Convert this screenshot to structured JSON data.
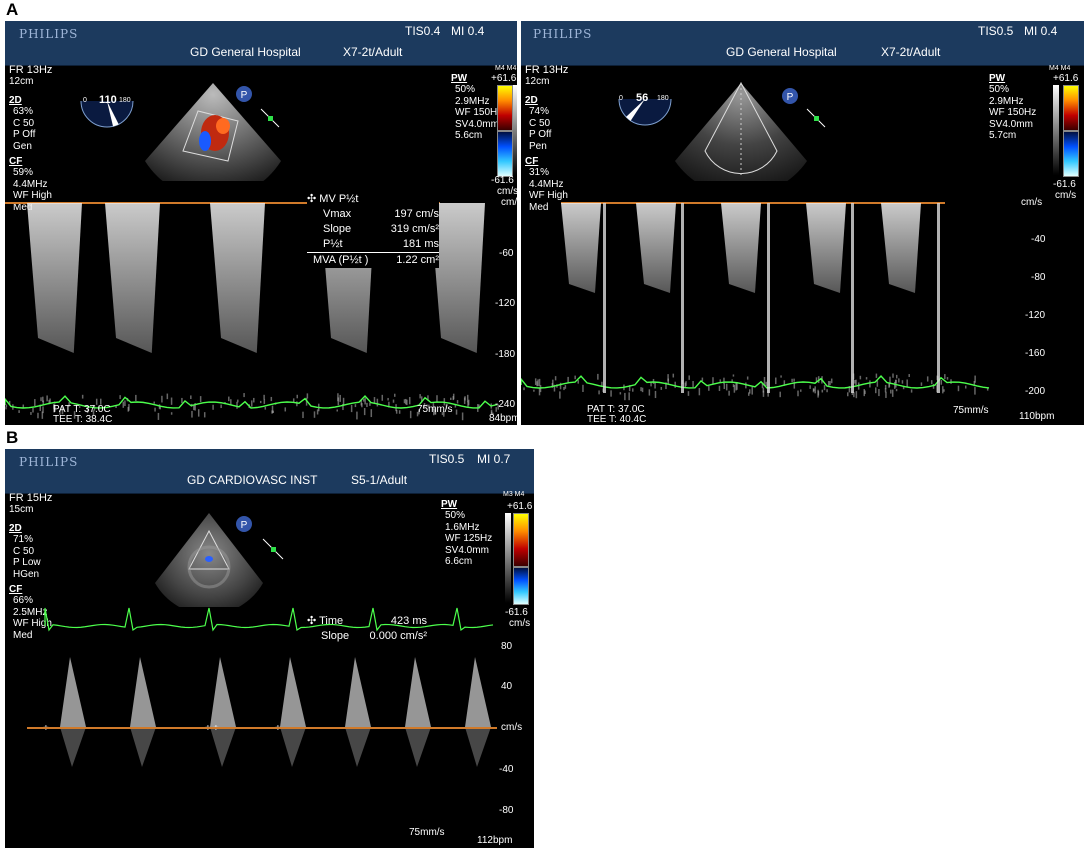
{
  "figure_labels": {
    "a": "A",
    "b": "B"
  },
  "panels": {
    "a1": {
      "logo": "PHILIPS",
      "tis": "TIS0.4",
      "mi": "MI 0.4",
      "hospital": "GD General Hospital",
      "probe": "X7-2t/Adult",
      "fr": "FR 13Hz",
      "depth": "12cm",
      "mode2d": "2D",
      "mode2d_vals": "63%\nC 50\nP Off\nGen",
      "cf": "CF",
      "cf_vals": "59%\n4.4MHz\nWF High\nMed",
      "angle": "110",
      "angle_min": "0",
      "angle_max": "180",
      "pw": "PW",
      "pw_vals": "50%\n2.9MHz\nWF 150Hz\nSV4.0mm\n5.6cm",
      "bar_head": "M4 M4",
      "bar_top": "+61.6",
      "bar_bottom": "-61.6",
      "bar_unit": "cm/s",
      "scale_unit": "cm/s",
      "scale": [
        "-60",
        "-120",
        "-180",
        "-240"
      ],
      "meas_title": "MV P½t",
      "meas": [
        {
          "k": "Vmax",
          "v": "197 cm/s"
        },
        {
          "k": "Slope",
          "v": "319 cm/s²"
        },
        {
          "k": "P½t",
          "v": "181 ms"
        },
        {
          "k": "MVA (P½t )",
          "v": "1.22 cm²"
        }
      ],
      "pat_t": "PAT T: 37.0C",
      "tee_t": "TEE T: 38.4C",
      "speed": "75mm/s",
      "hr": "84bpm"
    },
    "a2": {
      "logo": "PHILIPS",
      "tis": "TIS0.5",
      "mi": "MI 0.4",
      "hospital": "GD General Hospital",
      "probe": "X7-2t/Adult",
      "fr": "FR 13Hz",
      "depth": "12cm",
      "mode2d": "2D",
      "mode2d_vals": "74%\nC 50\nP Off\nPen",
      "cf": "CF",
      "cf_vals": "31%\n4.4MHz\nWF High\nMed",
      "angle": "56",
      "angle_min": "0",
      "angle_max": "180",
      "pw": "PW",
      "pw_vals": "50%\n2.9MHz\nWF 150Hz\nSV4.0mm\n5.7cm",
      "bar_head": "M4 M4",
      "bar_top": "+61.6",
      "bar_bottom": "-61.6",
      "bar_unit": "cm/s",
      "scale_unit": "cm/s",
      "scale": [
        "-40",
        "-80",
        "-120",
        "-160",
        "-200"
      ],
      "pat_t": "PAT T: 37.0C",
      "tee_t": "TEE T: 40.4C",
      "speed": "75mm/s",
      "hr": "110bpm"
    },
    "b": {
      "logo": "PHILIPS",
      "tis": "TIS0.5",
      "mi": "MI 0.7",
      "hospital": "GD CARDIOVASC INST",
      "probe": "S5-1/Adult",
      "fr": "FR 15Hz",
      "depth": "15cm",
      "mode2d": "2D",
      "mode2d_vals": "71%\nC 50\nP Low\nHGen",
      "cf": "CF",
      "cf_vals": "66%\n2.5MHz\nWF High\nMed",
      "pw": "PW",
      "pw_vals": "50%\n1.6MHz\nWF 125Hz\nSV4.0mm\n6.6cm",
      "bar_head": "M3 M4",
      "bar_top": "+61.6",
      "bar_bottom": "-61.6",
      "bar_unit": "cm/s",
      "scale_top": [
        "80",
        "40"
      ],
      "scale_unit": "cm/s",
      "scale_bottom": [
        "-40",
        "-80"
      ],
      "meas": [
        {
          "k": "Time",
          "v": "423 ms"
        },
        {
          "k": "Slope",
          "v": "0.000 cm/s²"
        }
      ],
      "speed": "75mm/s",
      "hr": "112bpm"
    }
  },
  "colors": {
    "header": "#1c3a5e",
    "ecg": "#4cff4c",
    "baseline": "#d07a2a"
  }
}
